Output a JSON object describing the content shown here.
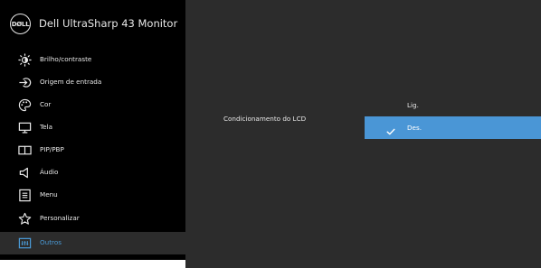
{
  "header": {
    "logo_text": "DØLL",
    "title": "Dell UltraSharp 43 Monitor"
  },
  "menu": {
    "items": [
      {
        "label": "Brilho/contraste",
        "icon": "brightness-icon"
      },
      {
        "label": "Origem de entrada",
        "icon": "input-source-icon"
      },
      {
        "label": "Cor",
        "icon": "color-palette-icon"
      },
      {
        "label": "Tela",
        "icon": "display-icon"
      },
      {
        "label": "PIP/PBP",
        "icon": "pip-pbp-icon"
      },
      {
        "label": "Áudio",
        "icon": "speaker-icon"
      },
      {
        "label": "Menu",
        "icon": "menu-list-icon"
      },
      {
        "label": "Personalizar",
        "icon": "star-icon"
      },
      {
        "label": "Outros",
        "icon": "others-icon"
      }
    ],
    "selected": "Outros"
  },
  "content": {
    "setting_label": "Condicionamento do LCD",
    "options": [
      {
        "label": "Lig.",
        "selected": false
      },
      {
        "label": "Des.",
        "selected": true
      }
    ]
  },
  "colors": {
    "accent": "#4a96d6",
    "sidebar_bg": "#000000",
    "panel_bg": "#2c2c2c",
    "text": "#e8e8e8"
  }
}
